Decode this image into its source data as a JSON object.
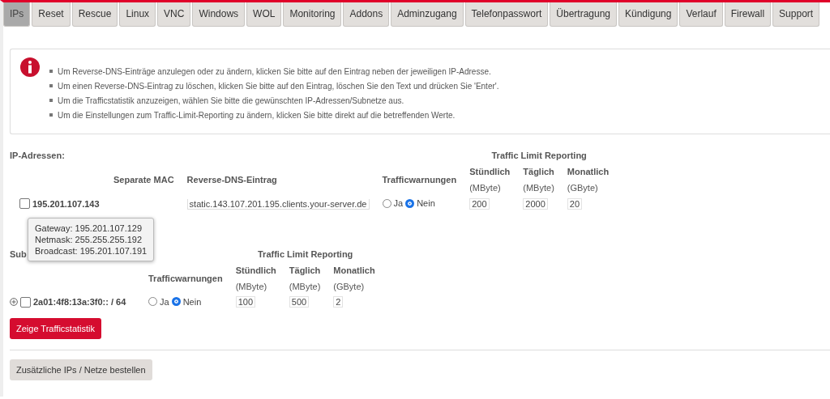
{
  "tabs": [
    {
      "label": "IPs",
      "selected": true
    },
    {
      "label": "Reset",
      "selected": false
    },
    {
      "label": "Rescue",
      "selected": false
    },
    {
      "label": "Linux",
      "selected": false
    },
    {
      "label": "VNC",
      "selected": false
    },
    {
      "label": "Windows",
      "selected": false
    },
    {
      "label": "WOL",
      "selected": false
    },
    {
      "label": "Monitoring",
      "selected": false
    },
    {
      "label": "Addons",
      "selected": false
    },
    {
      "label": "Adminzugang",
      "selected": false
    },
    {
      "label": "Telefonpasswort",
      "selected": false
    },
    {
      "label": "Übertragung",
      "selected": false
    },
    {
      "label": "Kündigung",
      "selected": false
    },
    {
      "label": "Verlauf",
      "selected": false
    },
    {
      "label": "Firewall",
      "selected": false
    },
    {
      "label": "Support",
      "selected": false
    }
  ],
  "info": [
    "Um Reverse-DNS-Einträge anzulegen oder zu ändern, klicken Sie bitte auf den Eintrag neben der jeweiligen IP-Adresse.",
    "Um einen Reverse-DNS-Eintrag zu löschen, klicken Sie bitte auf den Eintrag, löschen Sie den Text und drücken Sie 'Enter'.",
    "Um die Trafficstatistik anzuzeigen, wählen Sie bitte die gewünschten IP-Adressen/Subnetze aus.",
    "Um die Einstellungen zum Traffic-Limit-Reporting zu ändern, klicken Sie bitte direkt auf die betreffenden Werte."
  ],
  "ip_section": {
    "heading": "IP-Adressen:",
    "group_heading": "Traffic Limit Reporting",
    "columns": [
      "Separate MAC",
      "Reverse-DNS-Eintrag",
      "Trafficwarnungen"
    ],
    "limit_columns": [
      {
        "name": "Stündlich",
        "unit": "(MByte)"
      },
      {
        "name": "Täglich",
        "unit": "(MByte)"
      },
      {
        "name": "Monatlich",
        "unit": "(GByte)"
      }
    ],
    "rows": [
      {
        "checked": false,
        "address": "195.201.107.143",
        "rdns": "static.143.107.201.195.clients.your-server.de",
        "warnings": [
          {
            "label": "Ja",
            "selected": false
          },
          {
            "label": "Nein",
            "selected": true
          }
        ],
        "limits": [
          "200",
          "2000",
          "20"
        ]
      }
    ]
  },
  "tooltip": [
    "Gateway: 195.201.107.129",
    "Netmask: 255.255.255.192",
    "Broadcast: 195.201.107.191"
  ],
  "subnet_section": {
    "heading": "Sub",
    "group_heading": "Traffic Limit Reporting",
    "columns": [
      "Trafficwarnungen"
    ],
    "limit_columns": [
      {
        "name": "Stündlich",
        "unit": "(MByte)"
      },
      {
        "name": "Täglich",
        "unit": "(MByte)"
      },
      {
        "name": "Monatlich",
        "unit": "(GByte)"
      }
    ],
    "rows": [
      {
        "checked": false,
        "address": "2a01:4f8:13a:3f0:: / 64",
        "warnings": [
          {
            "label": "Ja",
            "selected": false
          },
          {
            "label": "Nein",
            "selected": true
          }
        ],
        "limits": [
          "100",
          "500",
          "2"
        ]
      }
    ]
  },
  "buttons": [
    "Zeige Trafficstatistik",
    "Zusätzliche IPs / Netze bestellen"
  ]
}
